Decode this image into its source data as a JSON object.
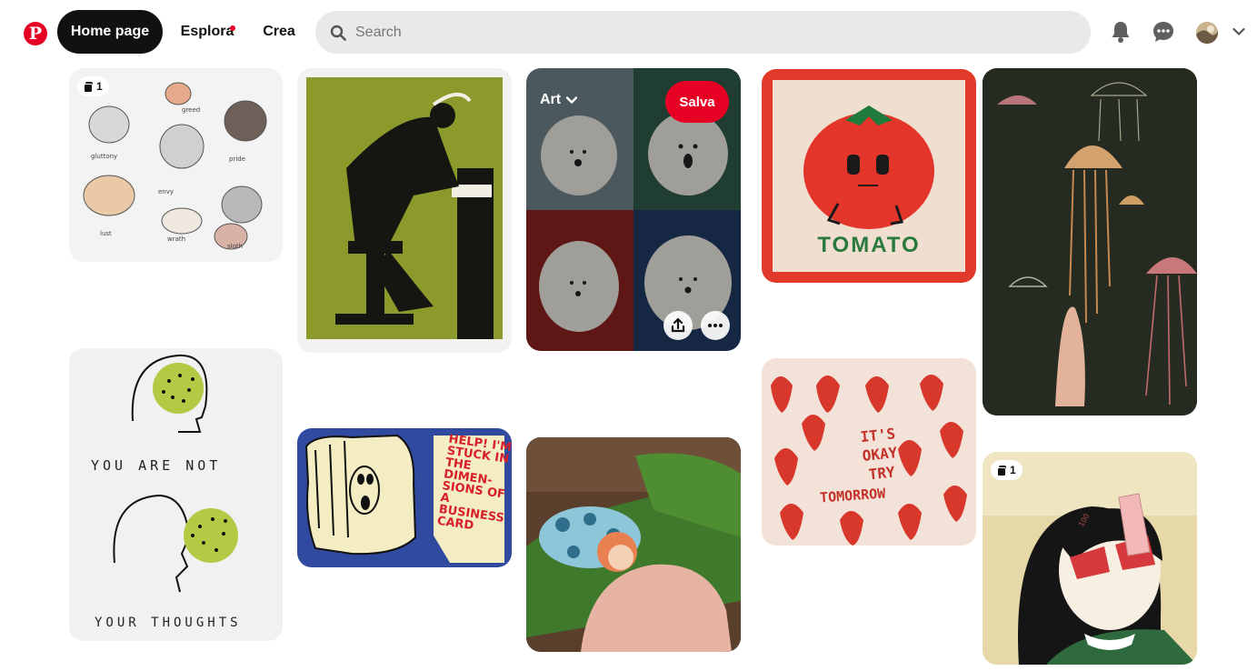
{
  "header": {
    "logo_letter": "P",
    "nav": {
      "home": "Home page",
      "explore": "Esplora",
      "create": "Crea"
    },
    "search_placeholder": "Search",
    "icons": [
      "pinterest-logo-icon",
      "search-icon",
      "bell-icon",
      "chat-icon",
      "avatar",
      "chevron-down-icon"
    ],
    "accent_color": "#e60023"
  },
  "pins": {
    "cats": {
      "badge_count": "1",
      "labels": [
        "gluttony",
        "greed",
        "pride",
        "envy",
        "lust",
        "wrath",
        "sloth"
      ]
    },
    "you_are_not": {
      "line1": "YOU ARE NOT",
      "line2": "YOUR THOUGHTS"
    },
    "help": {
      "text": "HELP! I'M STUCK IN THE DIMEN-SIONS OF A BUSINESS CARD"
    },
    "dogs": {
      "board": "Art",
      "save": "Salva",
      "icons": [
        "share-icon",
        "more-icon"
      ]
    },
    "tomato": {
      "title": "TOMATO"
    },
    "strawberry": {
      "line1": "IT'S",
      "line2": "OKAY",
      "line3": "TRY",
      "line4": "TOMORROW"
    },
    "girl": {
      "badge_count": "1",
      "banknote": "100"
    }
  }
}
